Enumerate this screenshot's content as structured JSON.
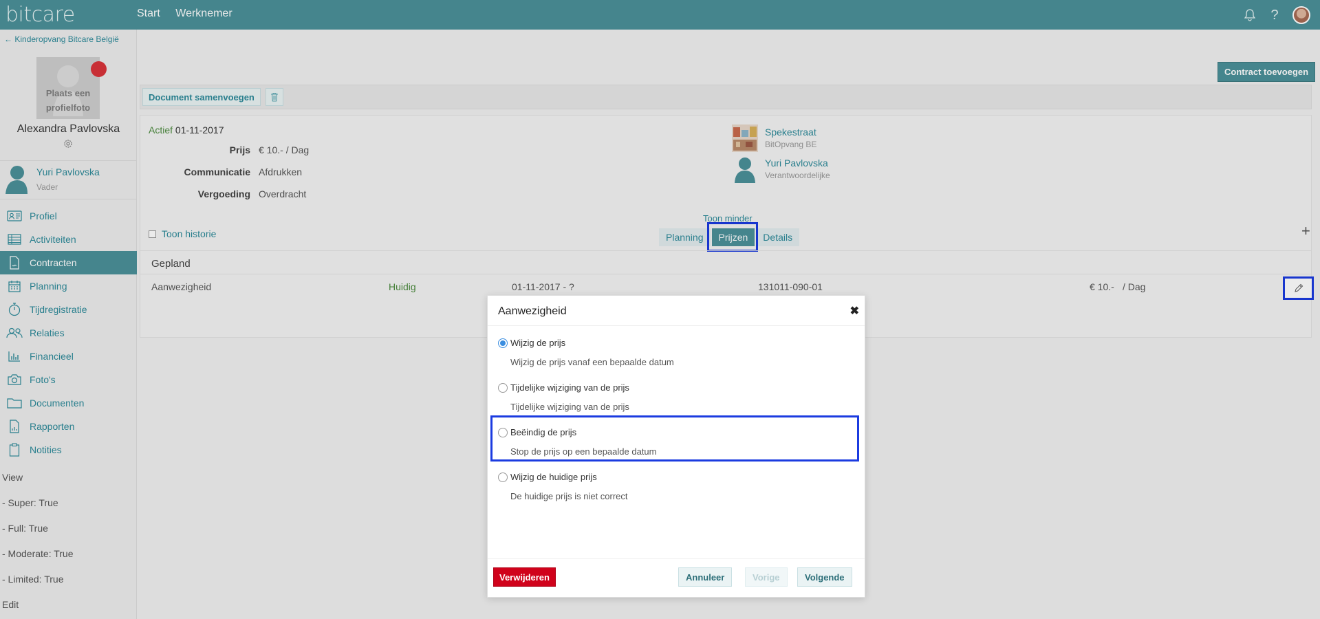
{
  "app": {
    "logo": "bitcare"
  },
  "topnav": [
    {
      "label": "Start"
    },
    {
      "label": "Werknemer"
    }
  ],
  "sidebar": {
    "back_label": "Kinderopvang Bitcare België",
    "photo_placeholder": "Plaats een profielfoto",
    "child_name": "Alexandra Pavlovska",
    "parent": {
      "name": "Yuri Pavlovska",
      "role": "Vader"
    },
    "menu": [
      {
        "label": "Profiel",
        "icon": "id-card-icon"
      },
      {
        "label": "Activiteiten",
        "icon": "table-icon"
      },
      {
        "label": "Contracten",
        "icon": "contract-icon",
        "active": true
      },
      {
        "label": "Planning",
        "icon": "calendar-icon"
      },
      {
        "label": "Tijdregistratie",
        "icon": "stopwatch-icon"
      },
      {
        "label": "Relaties",
        "icon": "people-icon"
      },
      {
        "label": "Financieel",
        "icon": "bar-chart-icon"
      },
      {
        "label": "Foto's",
        "icon": "camera-icon"
      },
      {
        "label": "Documenten",
        "icon": "folder-icon"
      },
      {
        "label": "Rapporten",
        "icon": "report-icon"
      },
      {
        "label": "Notities",
        "icon": "clipboard-icon"
      }
    ],
    "permissions": [
      "View",
      "- Super: True",
      "- Full: True",
      "- Moderate: True",
      "- Limited: True",
      "Edit"
    ]
  },
  "content": {
    "add_contract_label": "Contract toevoegen",
    "merge_doc_label": "Document samenvoegen",
    "contract": {
      "status": "Actief",
      "start_date": "01-11-2017",
      "fields": [
        {
          "key": "Prijs",
          "value": "€ 10.- / Dag"
        },
        {
          "key": "Communicatie",
          "value": "Afdrukken"
        },
        {
          "key": "Vergoeding",
          "value": "Overdracht"
        }
      ],
      "relations": [
        {
          "name": "Spekestraat",
          "sub": "BitOpvang BE"
        },
        {
          "name": "Yuri Pavlovska",
          "sub": "Verantwoordelijke"
        }
      ]
    },
    "toon_minder": "Toon minder",
    "toon_historie": "Toon historie",
    "tabs": [
      {
        "label": "Planning"
      },
      {
        "label": "Prijzen",
        "active": true
      },
      {
        "label": "Details"
      }
    ],
    "section_title": "Gepland",
    "row": {
      "type": "Aanwezigheid",
      "status": "Huidig",
      "period": "01-11-2017 - ?",
      "code": "131011-090-01",
      "price": "€ 10.-",
      "unit": "/ Dag"
    }
  },
  "modal": {
    "title": "Aanwezigheid",
    "options": [
      {
        "label": "Wijzig de prijs",
        "desc": "Wijzig de prijs vanaf een bepaalde datum",
        "selected": true
      },
      {
        "label": "Tijdelijke wijziging van de prijs",
        "desc": "Tijdelijke wijziging van de prijs",
        "selected": false
      },
      {
        "label": "Beëindig de prijs",
        "desc": "Stop de prijs op een bepaalde datum",
        "selected": false
      },
      {
        "label": "Wijzig de huidige prijs",
        "desc": "De huidige prijs is niet correct",
        "selected": false
      }
    ],
    "buttons": {
      "delete": "Verwijderen",
      "cancel": "Annuleer",
      "previous": "Vorige",
      "next": "Volgende"
    }
  },
  "colors": {
    "brand": "#4b9199",
    "link": "#2d8a9a",
    "danger": "#d0021b",
    "highlight": "#1b3be0",
    "status_ok": "#4b8a3d"
  }
}
